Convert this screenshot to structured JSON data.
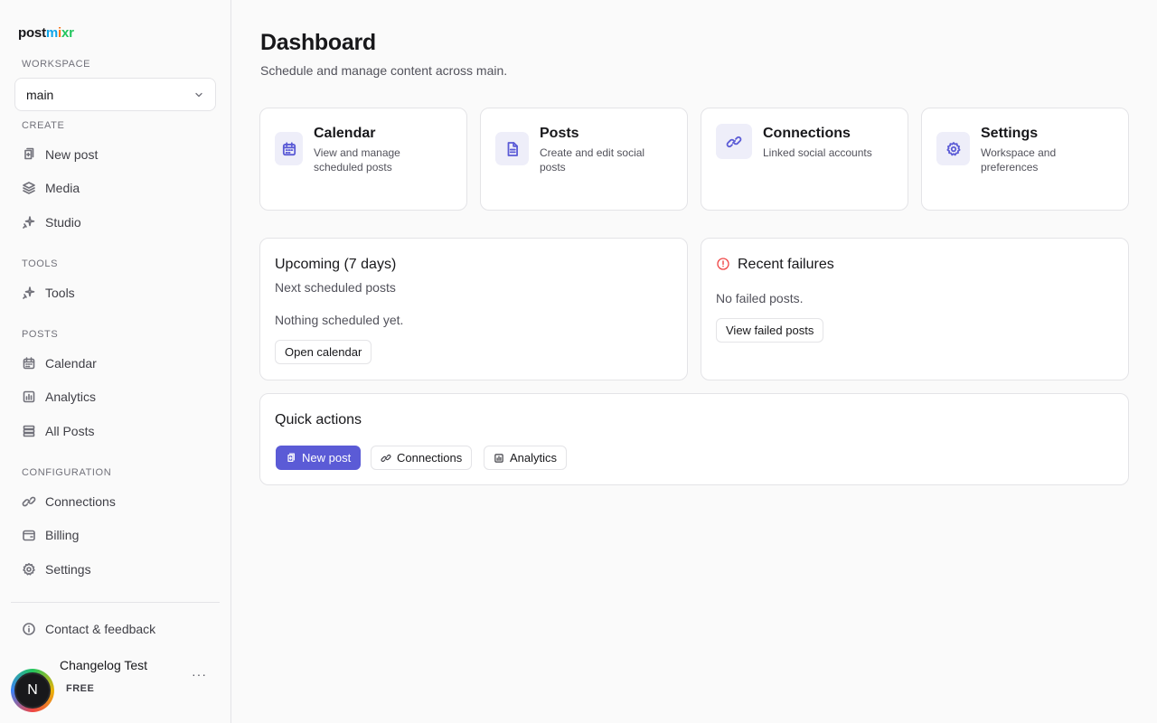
{
  "brand": {
    "logo_parts": [
      "post",
      "m",
      "i",
      "xr"
    ]
  },
  "colors": {
    "accent": "#5b5bd6",
    "icon_bg": "#eeeef9",
    "error": "#ef4444"
  },
  "sidebar": {
    "workspace_label": "WORKSPACE",
    "workspace_value": "main",
    "create_label": "CREATE",
    "create_items": [
      {
        "label": "New post",
        "icon": "new-post-icon"
      },
      {
        "label": "Media",
        "icon": "layers-icon"
      },
      {
        "label": "Studio",
        "icon": "sparkle-icon"
      }
    ],
    "tools_label": "TOOLS",
    "tools_items": [
      {
        "label": "Tools",
        "icon": "sparkle-icon"
      }
    ],
    "posts_label": "POSTS",
    "posts_items": [
      {
        "label": "Calendar",
        "icon": "calendar-icon"
      },
      {
        "label": "Analytics",
        "icon": "bar-chart-icon"
      },
      {
        "label": "All Posts",
        "icon": "list-icon"
      }
    ],
    "config_label": "CONFIGURATION",
    "config_items": [
      {
        "label": "Connections",
        "icon": "link-icon"
      },
      {
        "label": "Billing",
        "icon": "wallet-icon"
      },
      {
        "label": "Settings",
        "icon": "gear-icon"
      }
    ],
    "contact": {
      "label": "Contact & feedback",
      "icon": "info-icon"
    },
    "user": {
      "name": "Changelog Test",
      "plan": "FREE",
      "initial": "N",
      "more": "···"
    }
  },
  "main": {
    "title": "Dashboard",
    "subtitle": "Schedule and manage content across main.",
    "nav_cards": [
      {
        "title": "Calendar",
        "desc_lines": [
          "View and manage",
          "scheduled posts"
        ],
        "icon": "calendar-icon"
      },
      {
        "title": "Posts",
        "desc_lines": [
          "Create and edit social",
          "posts"
        ],
        "icon": "document-icon"
      },
      {
        "title": "Connections",
        "desc_lines": [
          "Linked social accounts"
        ],
        "icon": "link-icon"
      },
      {
        "title": "Settings",
        "desc_lines": [
          "Workspace and",
          "preferences"
        ],
        "icon": "gear-icon"
      }
    ],
    "upcoming": {
      "title": "Upcoming (7 days)",
      "subtitle": "Next scheduled posts",
      "empty": "Nothing scheduled yet.",
      "button": "Open calendar"
    },
    "failures": {
      "title": "Recent failures",
      "icon": "alert-icon",
      "empty": "No failed posts.",
      "button": "View failed posts"
    },
    "quick_actions": {
      "title": "Quick actions",
      "buttons": [
        {
          "label": "New post",
          "icon": "new-post-icon"
        },
        {
          "label": "Connections",
          "icon": "link-icon"
        },
        {
          "label": "Analytics",
          "icon": "bar-chart-icon"
        }
      ]
    }
  }
}
